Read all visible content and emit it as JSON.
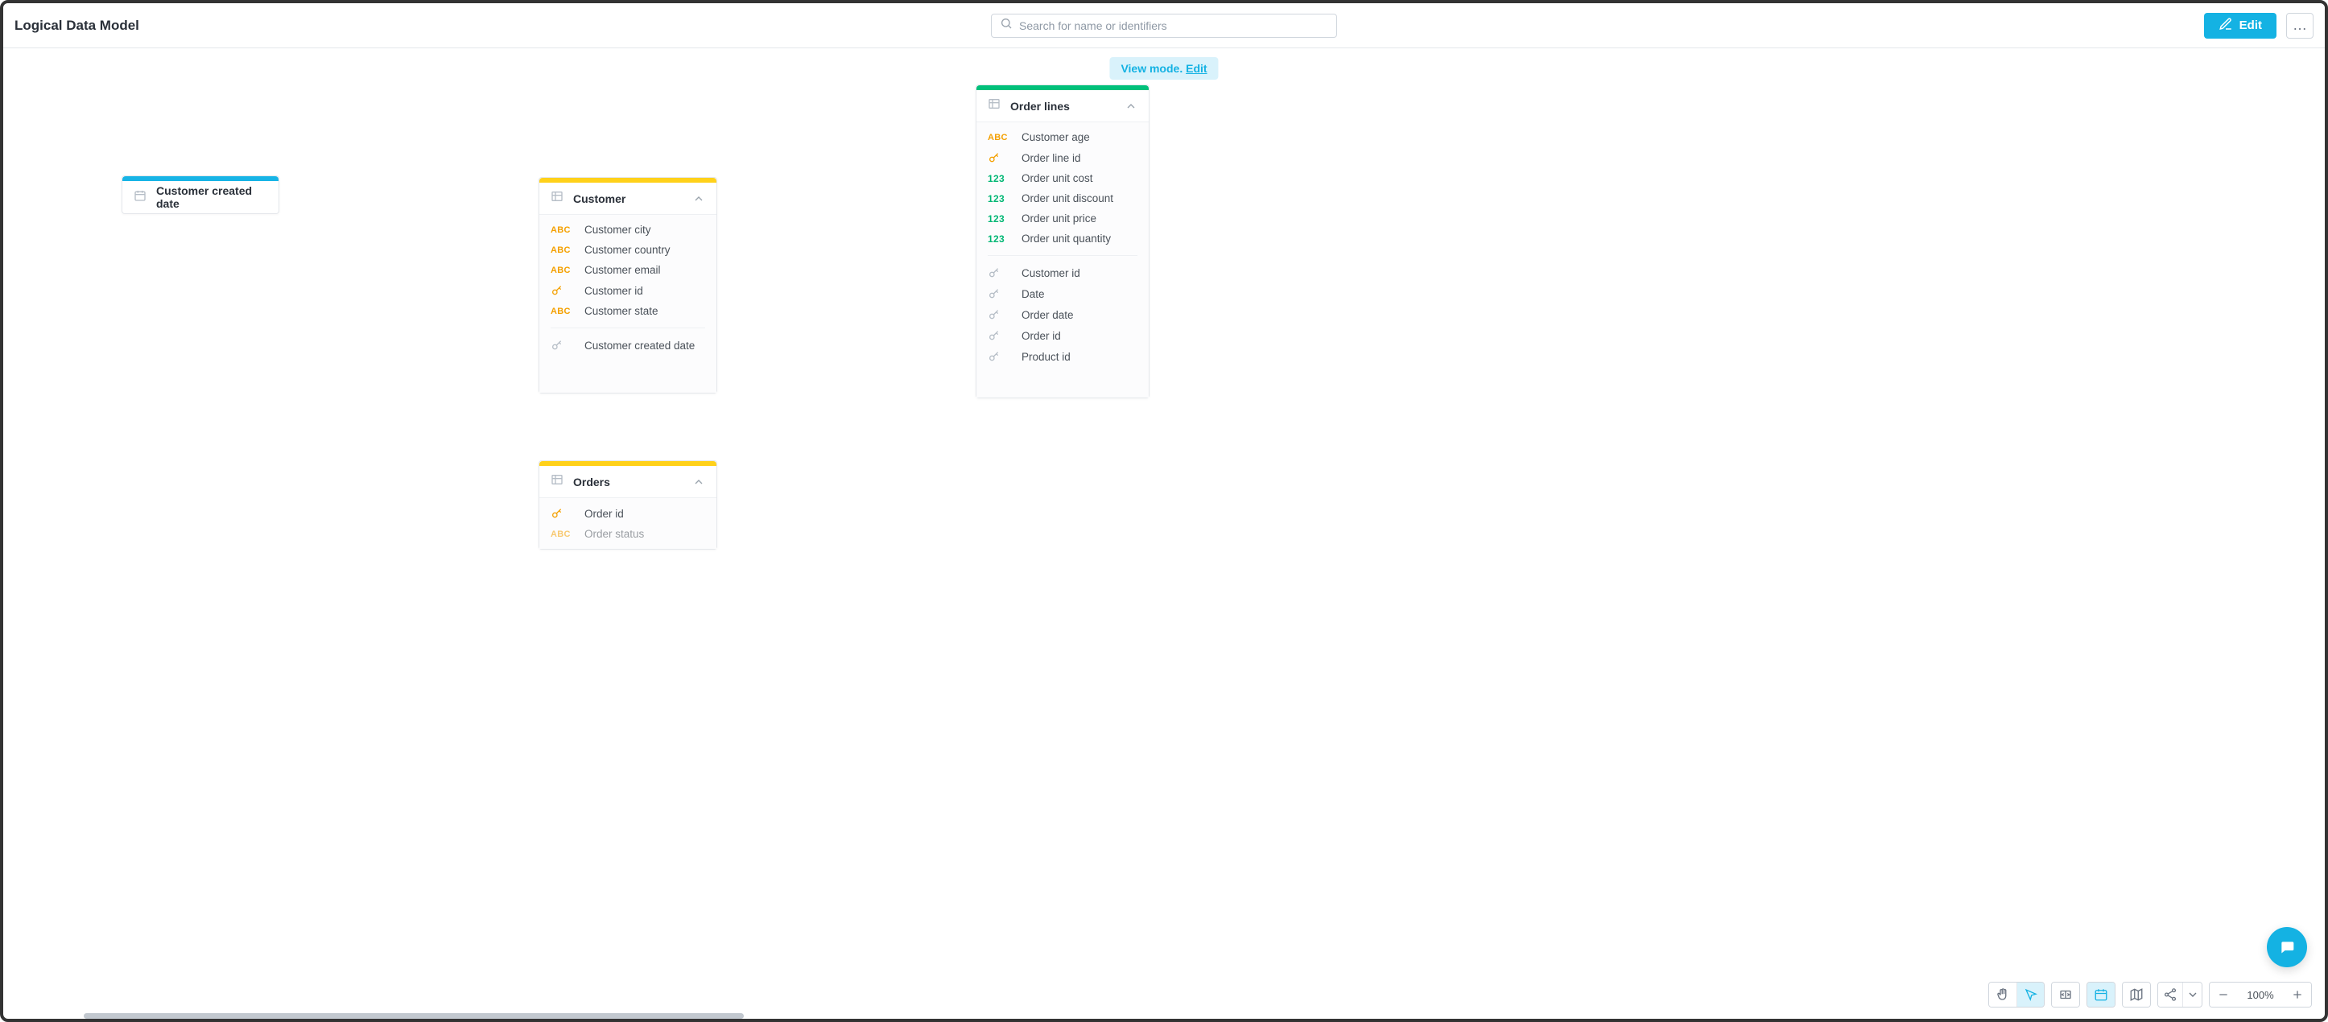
{
  "header": {
    "title": "Logical Data Model",
    "search_placeholder": "Search for name or identifiers",
    "edit_label": "Edit",
    "more_label": "…"
  },
  "view_mode": {
    "text": "View mode.",
    "link": "Edit"
  },
  "nodes": {
    "customer_created_date": {
      "title": "Customer created date",
      "color": "#17b4e6",
      "header_icon": "calendar"
    },
    "customer": {
      "title": "Customer",
      "color": "#ffd11a",
      "header_icon": "table",
      "fields": [
        {
          "type": "abc",
          "label": "Customer city"
        },
        {
          "type": "abc",
          "label": "Customer country"
        },
        {
          "type": "abc",
          "label": "Customer email"
        },
        {
          "type": "key",
          "label": "Customer id"
        },
        {
          "type": "abc",
          "label": "Customer state"
        }
      ],
      "refs": [
        {
          "type": "ref",
          "label": "Customer created date"
        }
      ]
    },
    "orders": {
      "title": "Orders",
      "color": "#ffd11a",
      "header_icon": "table",
      "fields": [
        {
          "type": "key",
          "label": "Order id"
        },
        {
          "type": "abc",
          "label": "Order status"
        }
      ]
    },
    "order_lines": {
      "title": "Order lines",
      "color": "#00c07a",
      "header_icon": "table",
      "fields": [
        {
          "type": "abc",
          "label": "Customer age"
        },
        {
          "type": "key",
          "label": "Order line id"
        },
        {
          "type": "num",
          "label": "Order unit cost"
        },
        {
          "type": "num",
          "label": "Order unit discount"
        },
        {
          "type": "num",
          "label": "Order unit price"
        },
        {
          "type": "num",
          "label": "Order unit quantity"
        }
      ],
      "refs": [
        {
          "type": "ref",
          "label": "Customer id"
        },
        {
          "type": "ref",
          "label": "Date"
        },
        {
          "type": "ref",
          "label": "Order date"
        },
        {
          "type": "ref",
          "label": "Order id"
        },
        {
          "type": "ref",
          "label": "Product id"
        }
      ]
    }
  },
  "toolbar": {
    "zoom": "100%",
    "buttons": [
      "pan",
      "select",
      "fit",
      "calendar",
      "map",
      "share-drop",
      "zoom-out",
      "zoom-in"
    ]
  }
}
